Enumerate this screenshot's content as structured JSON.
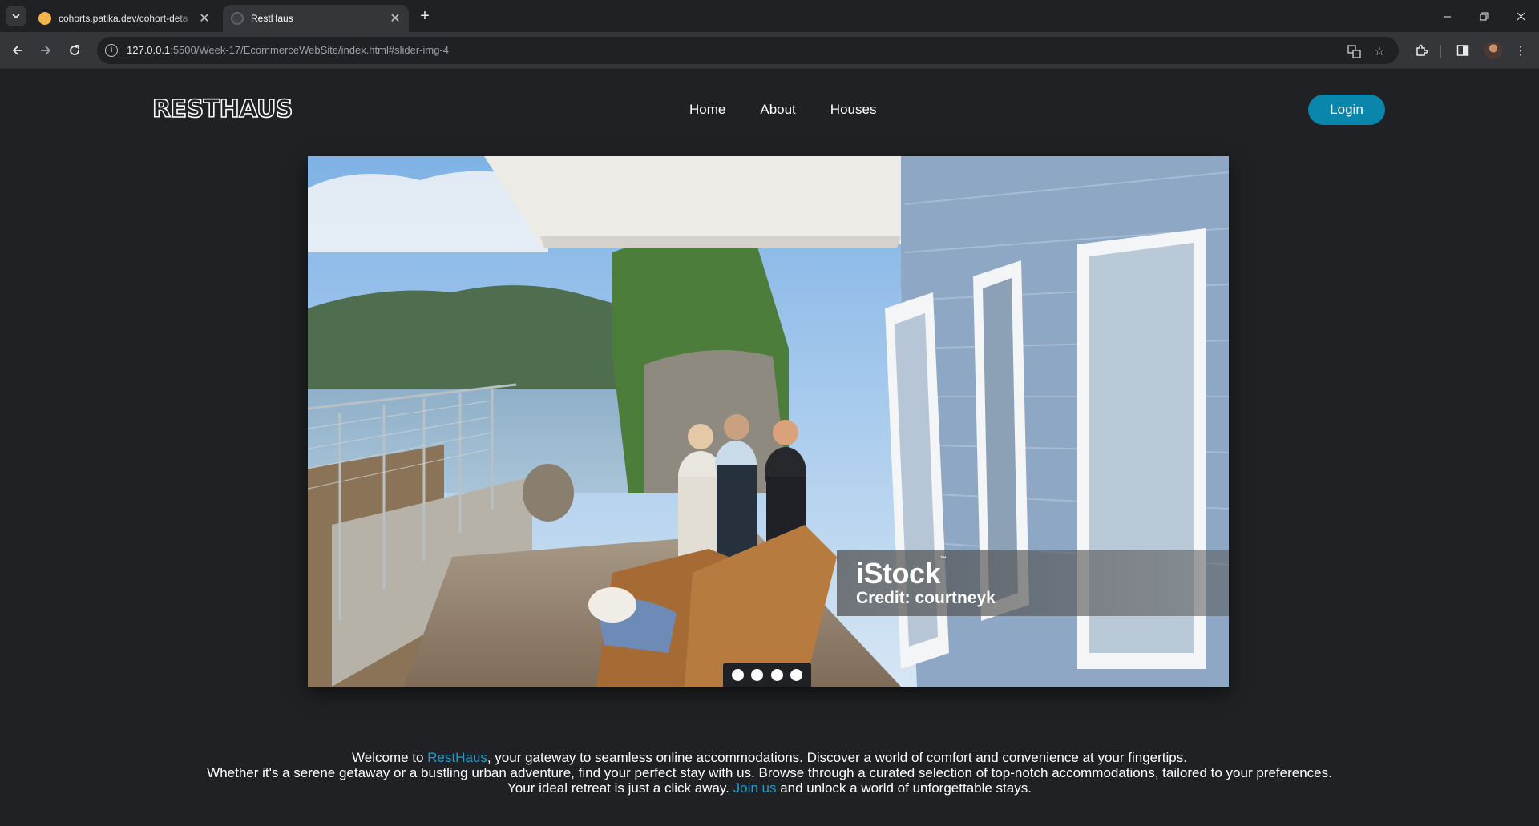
{
  "browser": {
    "tabs": [
      {
        "title": "cohorts.patika.dev/cohort-deta",
        "active": false
      },
      {
        "title": "RestHaus",
        "active": true
      }
    ],
    "url_host": "127.0.0.1",
    "url_rest": ":5500/Week-17/EcommerceWebSite/index.html#slider-img-4",
    "icons": [
      "tab-search-icon",
      "close-icon",
      "plus-icon",
      "back-arrow-icon",
      "forward-arrow-icon",
      "reload-icon",
      "site-info-icon",
      "translate-icon",
      "bookmark-star-icon",
      "extensions-icon",
      "side-panel-icon",
      "minimize-icon",
      "restore-icon",
      "close-window-icon"
    ]
  },
  "site": {
    "logo": "RESTHAUS",
    "nav": [
      "Home",
      "About",
      "Houses"
    ],
    "login_label": "Login",
    "brand_color": "#0a86ad"
  },
  "slider": {
    "watermark_brand": "iStock",
    "watermark_tm": "™",
    "watermark_credit": "Credit: courtneyk",
    "dot_count": 4
  },
  "intro": {
    "line1_pre": "Welcome to ",
    "line1_brand": "RestHaus",
    "line1_post": ", your gateway to seamless online accommodations. Discover a world of comfort and convenience at your fingertips.",
    "line2": "Whether it's a serene getaway or a bustling urban adventure, find your perfect stay with us. Browse through a curated selection of top-notch accommodations, tailored to your preferences.",
    "line3_pre": "Your ideal retreat is just a click away. ",
    "line3_link": "Join us",
    "line3_post": " and unlock a world of unforgettable stays.",
    "accent_color": "#1e9ccc"
  }
}
